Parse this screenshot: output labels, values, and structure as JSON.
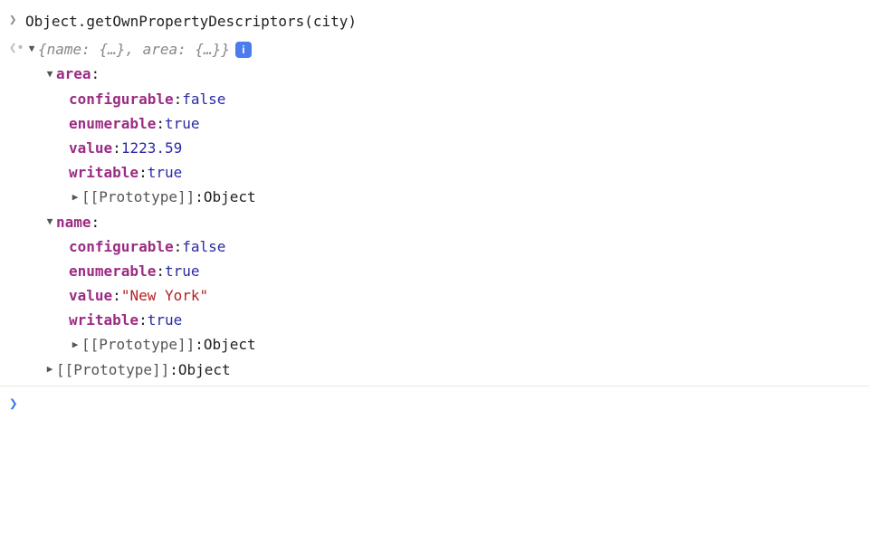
{
  "input": {
    "expression": "Object.getOwnPropertyDescriptors(city)"
  },
  "result": {
    "preview_open": "{",
    "preview_name1": "name:",
    "preview_val1": " {…}",
    "preview_sep": ", ",
    "preview_name2": "area:",
    "preview_val2": " {…}",
    "preview_close": "}",
    "info_badge": "i"
  },
  "area": {
    "label": "area",
    "configurable": {
      "key": "configurable",
      "value": "false"
    },
    "enumerable": {
      "key": "enumerable",
      "value": "true"
    },
    "value": {
      "key": "value",
      "value": "1223.59"
    },
    "writable": {
      "key": "writable",
      "value": "true"
    },
    "prototype": {
      "key": "[[Prototype]]",
      "value": "Object"
    }
  },
  "name": {
    "label": "name",
    "configurable": {
      "key": "configurable",
      "value": "false"
    },
    "enumerable": {
      "key": "enumerable",
      "value": "true"
    },
    "value": {
      "key": "value",
      "value": "\"New York\""
    },
    "writable": {
      "key": "writable",
      "value": "true"
    },
    "prototype": {
      "key": "[[Prototype]]",
      "value": "Object"
    }
  },
  "root_prototype": {
    "key": "[[Prototype]]",
    "value": "Object"
  },
  "colon": ": "
}
